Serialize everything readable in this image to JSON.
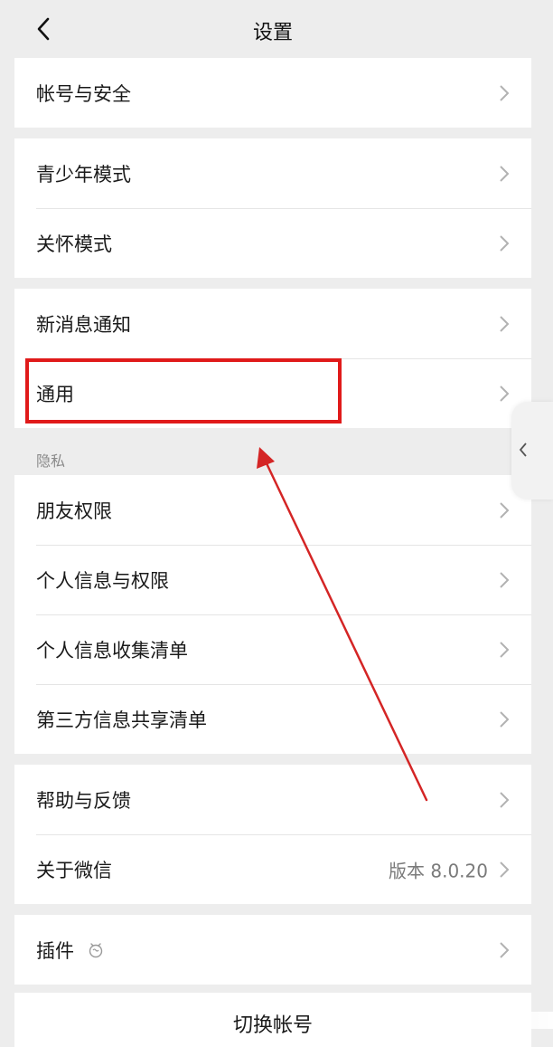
{
  "header": {
    "title": "设置",
    "back_icon": "chevron-left-icon"
  },
  "groups": [
    {
      "items": [
        {
          "label": "帐号与安全"
        }
      ]
    },
    {
      "items": [
        {
          "label": "青少年模式"
        },
        {
          "label": "关怀模式"
        }
      ]
    },
    {
      "items": [
        {
          "label": "新消息通知"
        },
        {
          "label": "通用"
        }
      ]
    },
    {
      "section_title": "隐私",
      "items": [
        {
          "label": "朋友权限"
        },
        {
          "label": "个人信息与权限"
        },
        {
          "label": "个人信息收集清单"
        },
        {
          "label": "第三方信息共享清单"
        }
      ]
    },
    {
      "items": [
        {
          "label": "帮助与反馈"
        },
        {
          "label": "关于微信",
          "value": "版本 8.0.20"
        }
      ]
    },
    {
      "items": [
        {
          "label": "插件",
          "icon": "plugin-icon"
        }
      ]
    }
  ],
  "footer": {
    "switch_account": "切换帐号"
  },
  "annotation": {
    "highlight_color": "#e01a1a",
    "arrow_color": "#d42525",
    "target": "通用"
  }
}
